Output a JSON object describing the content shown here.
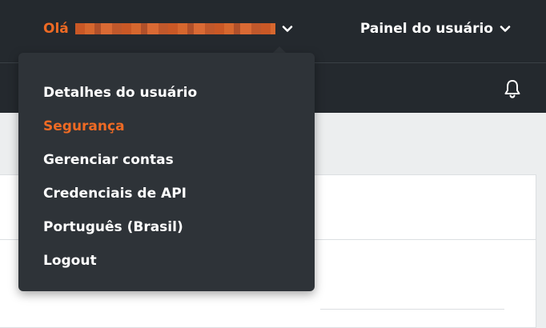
{
  "header": {
    "greeting": "Olá",
    "user_panel_label": "Painel do usuário"
  },
  "dropdown": {
    "items": [
      {
        "label": "Detalhes do usuário",
        "active": false
      },
      {
        "label": "Segurança",
        "active": true
      },
      {
        "label": "Gerenciar contas",
        "active": false
      },
      {
        "label": "Credenciais de API",
        "active": false
      },
      {
        "label": "Português (Brasil)",
        "active": false
      },
      {
        "label": "Logout",
        "active": false
      }
    ]
  },
  "icons": {
    "greeting_chevron": "chevron-down-icon",
    "panel_chevron": "chevron-down-icon",
    "notifications": "bell-icon"
  },
  "colors": {
    "accent": "#ee6a24",
    "header_bg": "#24292e",
    "menu_bg": "#2e3338",
    "text_light": "#ffffff"
  }
}
